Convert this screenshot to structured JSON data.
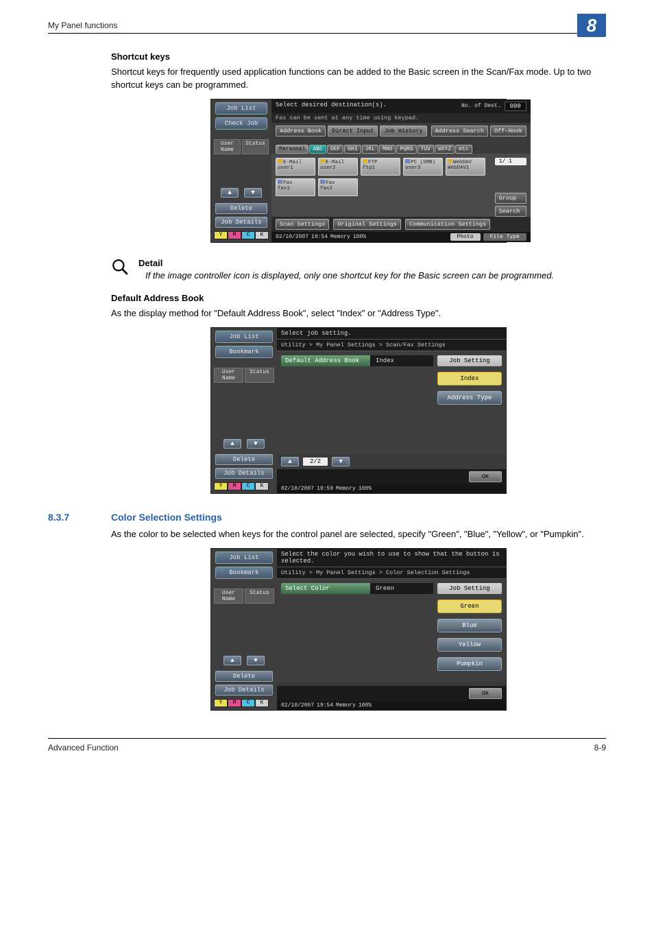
{
  "page": {
    "header": "My Panel functions",
    "chapter": "8",
    "footer_left": "Advanced Function",
    "footer_right": "8-9"
  },
  "sec1": {
    "title": "Shortcut keys",
    "body": "Shortcut keys for frequently used application functions can be added to the Basic screen in the Scan/Fax mode. Up to two shortcut keys can be programmed."
  },
  "detail": {
    "label": "Detail",
    "text": "If the image controller icon is displayed, only one shortcut key for the Basic screen can be programmed."
  },
  "sec2": {
    "title": "Default Address Book",
    "body": "As the display method for \"Default Address Book\", select \"Index\" or \"Address Type\"."
  },
  "sec3": {
    "num": "8.3.7",
    "title": "Color Selection Settings",
    "body": "As the color to be selected when keys for the control panel are selected, specify \"Green\", \"Blue\", \"Yellow\", or \"Pumpkin\"."
  },
  "panelA": {
    "job_list": "Job List",
    "check_job": "Check Job",
    "user_name": "User Name",
    "status": "Status",
    "delete": "Delete",
    "job_details": "Job Details",
    "instr": "Select desired destination(s).",
    "instr2": "Fax can be sent at any time using keypad.",
    "dest_lbl": "No. of Dest.",
    "dest_val": "000",
    "tabs_top": [
      "Address Book",
      "Direct Input",
      "Job History",
      "Address Search",
      "Off-Hook"
    ],
    "tabs_idx": [
      "Personal",
      "ABC",
      "DEF",
      "GHI",
      "JKL",
      "MNO",
      "PQRS",
      "TUV",
      "WXYZ",
      "etc"
    ],
    "cards": [
      {
        "t1": "E-Mail",
        "t2": "user1",
        "cls": "email"
      },
      {
        "t1": "E-Mail",
        "t2": "user2",
        "cls": "email"
      },
      {
        "t1": "FTP",
        "t2": "ftp1",
        "cls": "ftp"
      },
      {
        "t1": "PC (SMB)",
        "t2": "user3",
        "cls": "pc"
      },
      {
        "t1": "WebDAV",
        "t2": "WebDAV1",
        "cls": "web"
      },
      {
        "t1": "Fax",
        "t2": "fax1",
        "cls": "fax"
      },
      {
        "t1": "Fax",
        "t2": "fax2",
        "cls": "fax"
      }
    ],
    "page": "1/  1",
    "group": "Group",
    "search": "Search",
    "bottom": [
      "Scan Settings",
      "Original Settings",
      "Communication Settings"
    ],
    "date": "02/10/2007",
    "time": "19:54",
    "mem": "Memory",
    "memv": "100%",
    "photo": "Photo",
    "filetype": "File Type"
  },
  "panelB": {
    "job_list": "Job List",
    "bookmark": "Bookmark",
    "user_name": "User Name",
    "status": "Status",
    "delete": "Delete",
    "job_details": "Job Details",
    "instr": "Select job setting.",
    "breadcrumb": "Utility > My Panel Settings > Scan/Fax Settings",
    "row_key": "Default Address Book",
    "row_val": "Index",
    "right_title": "Job Setting",
    "opts": [
      "Index",
      "Address Type"
    ],
    "sel": 0,
    "page": "2/2",
    "date": "02/10/2007",
    "time": "19:59",
    "mem": "Memory",
    "memv": "100%",
    "ok": "OK"
  },
  "panelC": {
    "job_list": "Job List",
    "bookmark": "Bookmark",
    "user_name": "User Name",
    "status": "Status",
    "delete": "Delete",
    "job_details": "Job Details",
    "instr": "Select the color you wish to use to show that the button is selected.",
    "breadcrumb": "Utility > My Panel Settings > Color Selection Settings",
    "row_key": "Select Color",
    "row_val": "Green",
    "right_title": "Job Setting",
    "opts": [
      "Green",
      "Blue",
      "Yellow",
      "Pumpkin"
    ],
    "sel": 0,
    "date": "02/10/2007",
    "time": "19:54",
    "mem": "Memory",
    "memv": "100%",
    "ok": "OK"
  }
}
